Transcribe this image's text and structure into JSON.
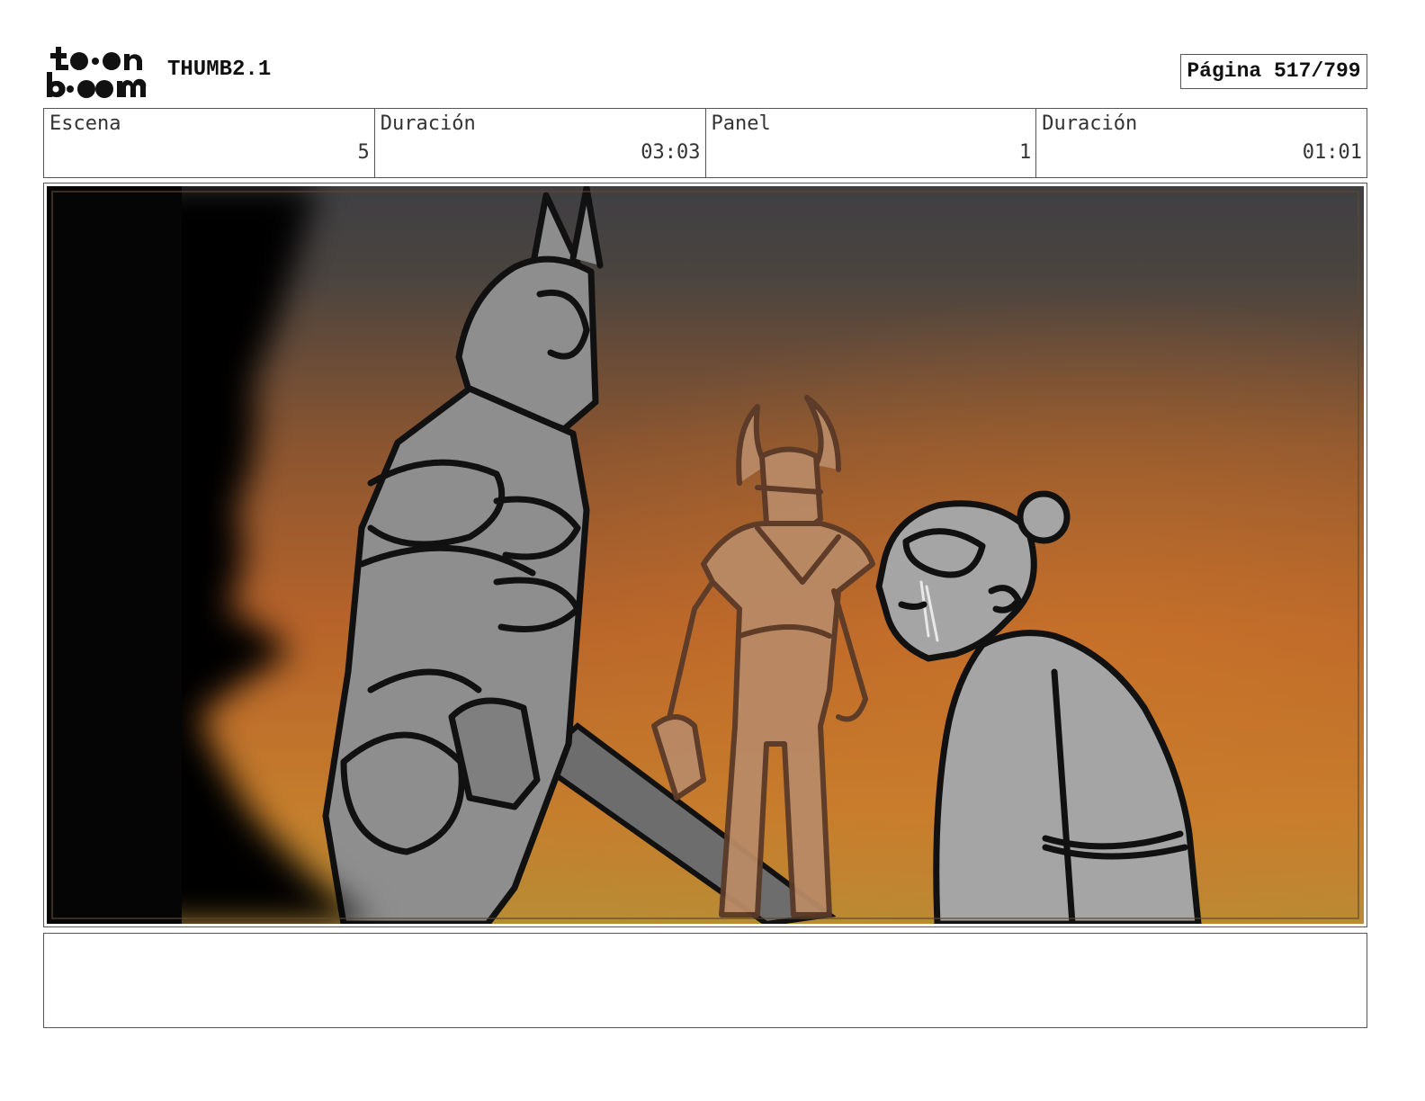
{
  "header": {
    "logo_top": "to●n",
    "logo_bottom": "b●●m",
    "doc_title": "THUMB2.1",
    "page_label": "Página 517/799"
  },
  "info": {
    "scene_label": "Escena",
    "scene_value": "5",
    "scene_duration_label": "Duración",
    "scene_duration_value": "03:03",
    "panel_label": "Panel",
    "panel_value": "1",
    "panel_duration_label": "Duración",
    "panel_duration_value": "01:01"
  },
  "panel": {
    "sky_top_color": "#3f3f42",
    "sky_bottom_color": "#c78a2a",
    "figure_gray": "#9a9a9a",
    "warrior_tan": "#b98a66"
  },
  "notes": {
    "text": ""
  }
}
